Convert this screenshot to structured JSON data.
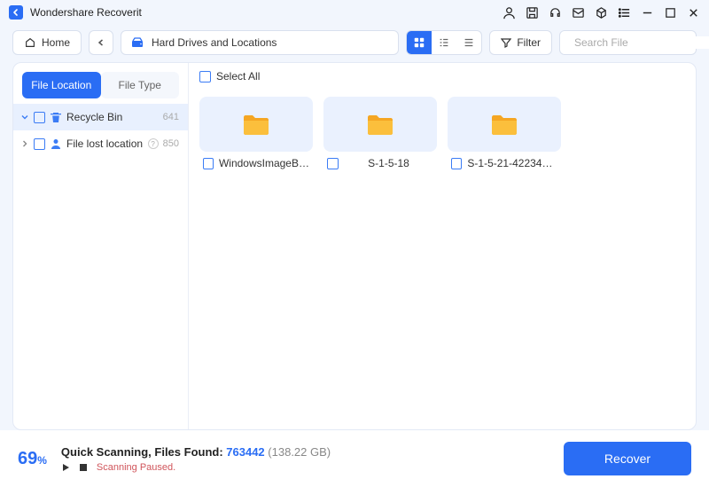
{
  "app": {
    "title": "Wondershare Recoverit"
  },
  "toolbar": {
    "home": "Home",
    "location": "Hard Drives and Locations",
    "filter": "Filter",
    "search_placeholder": "Search File"
  },
  "sidebar": {
    "tabs": {
      "location": "File Location",
      "type": "File Type"
    },
    "items": [
      {
        "label": "Recycle Bin",
        "count": "641"
      },
      {
        "label": "File lost location",
        "count": "850"
      }
    ]
  },
  "content": {
    "select_all": "Select All",
    "folders": [
      {
        "name": "WindowsImageBac..."
      },
      {
        "name": "S-1-5-18"
      },
      {
        "name": "S-1-5-21-4223439..."
      }
    ]
  },
  "status": {
    "percent": "69",
    "percent_suffix": "%",
    "scan_label": "Quick Scanning, Files Found: ",
    "files_found": "763442",
    "size": "(138.22 GB)",
    "paused": "Scanning Paused.",
    "recover": "Recover"
  }
}
